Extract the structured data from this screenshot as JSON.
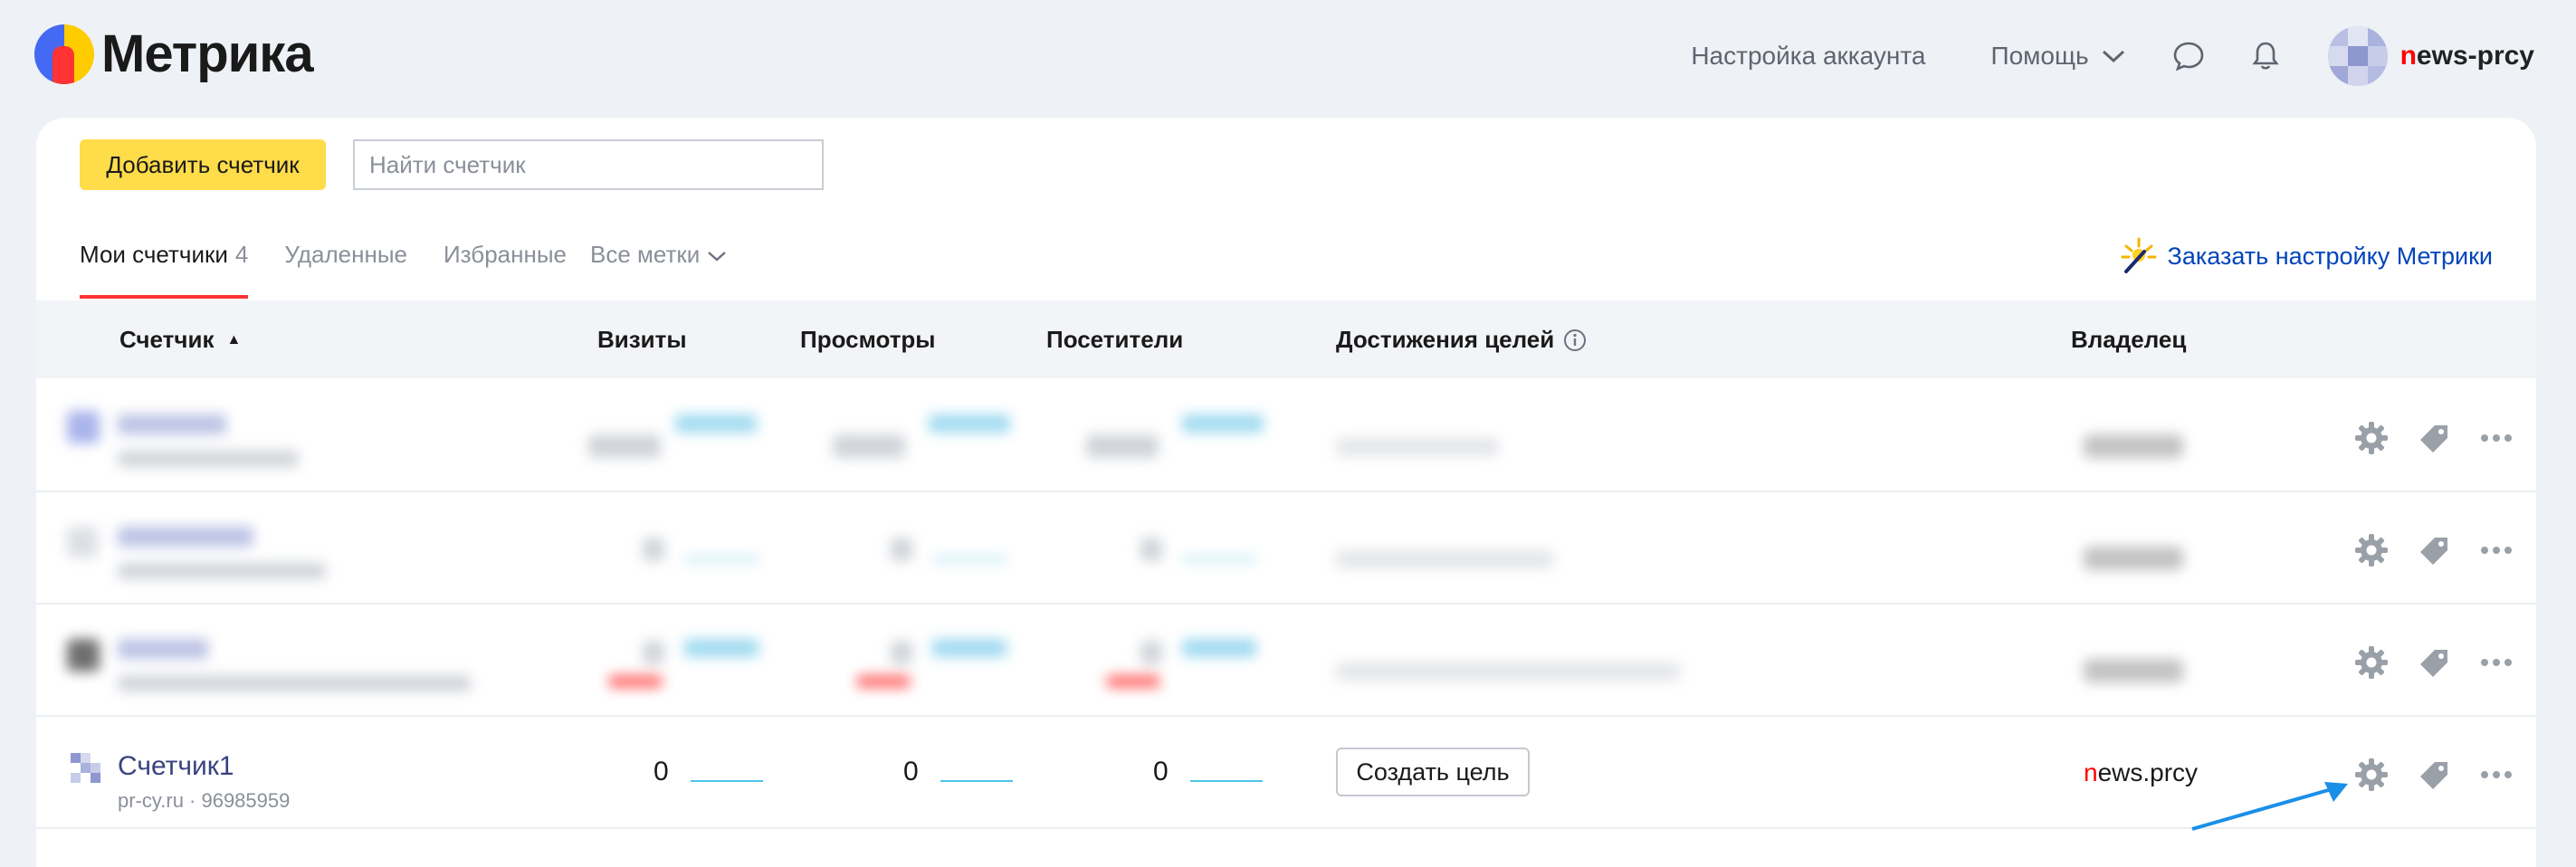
{
  "brand": {
    "logo_text": "Метрика"
  },
  "header": {
    "account_settings": "Настройка аккаунта",
    "help": "Помощь",
    "user_first_letter": "n",
    "user_rest": "ews-prcy"
  },
  "toolbar": {
    "add_counter": "Добавить счетчик",
    "search_placeholder": "Найти счетчик"
  },
  "tabs": [
    {
      "label": "Мои счетчики",
      "count": "4",
      "active": true
    },
    {
      "label": "Удаленные"
    },
    {
      "label": "Избранные"
    },
    {
      "label": "Все метки"
    }
  ],
  "order_setup": "Заказать настройку Метрики",
  "table": {
    "columns": {
      "counter": "Счетчик",
      "sort_indicator": "▲",
      "visits": "Визиты",
      "views": "Просмотры",
      "visitors": "Посетители",
      "goals": "Достижения целей",
      "owner": "Владелец"
    },
    "rows": [
      {
        "name": "Счетчик1",
        "site": "pr-cy.ru · 96985959",
        "visits": "0",
        "views": "0",
        "visitors": "0",
        "goal_button": "Создать цель",
        "owner_first": "n",
        "owner_rest": "ews.prcy"
      }
    ]
  },
  "colors": {
    "accent_yellow": "#ffdc4a",
    "active_tab_underline": "#ff3333",
    "link_blue": "#0044bb",
    "sparkline": "#4cc5e8"
  }
}
